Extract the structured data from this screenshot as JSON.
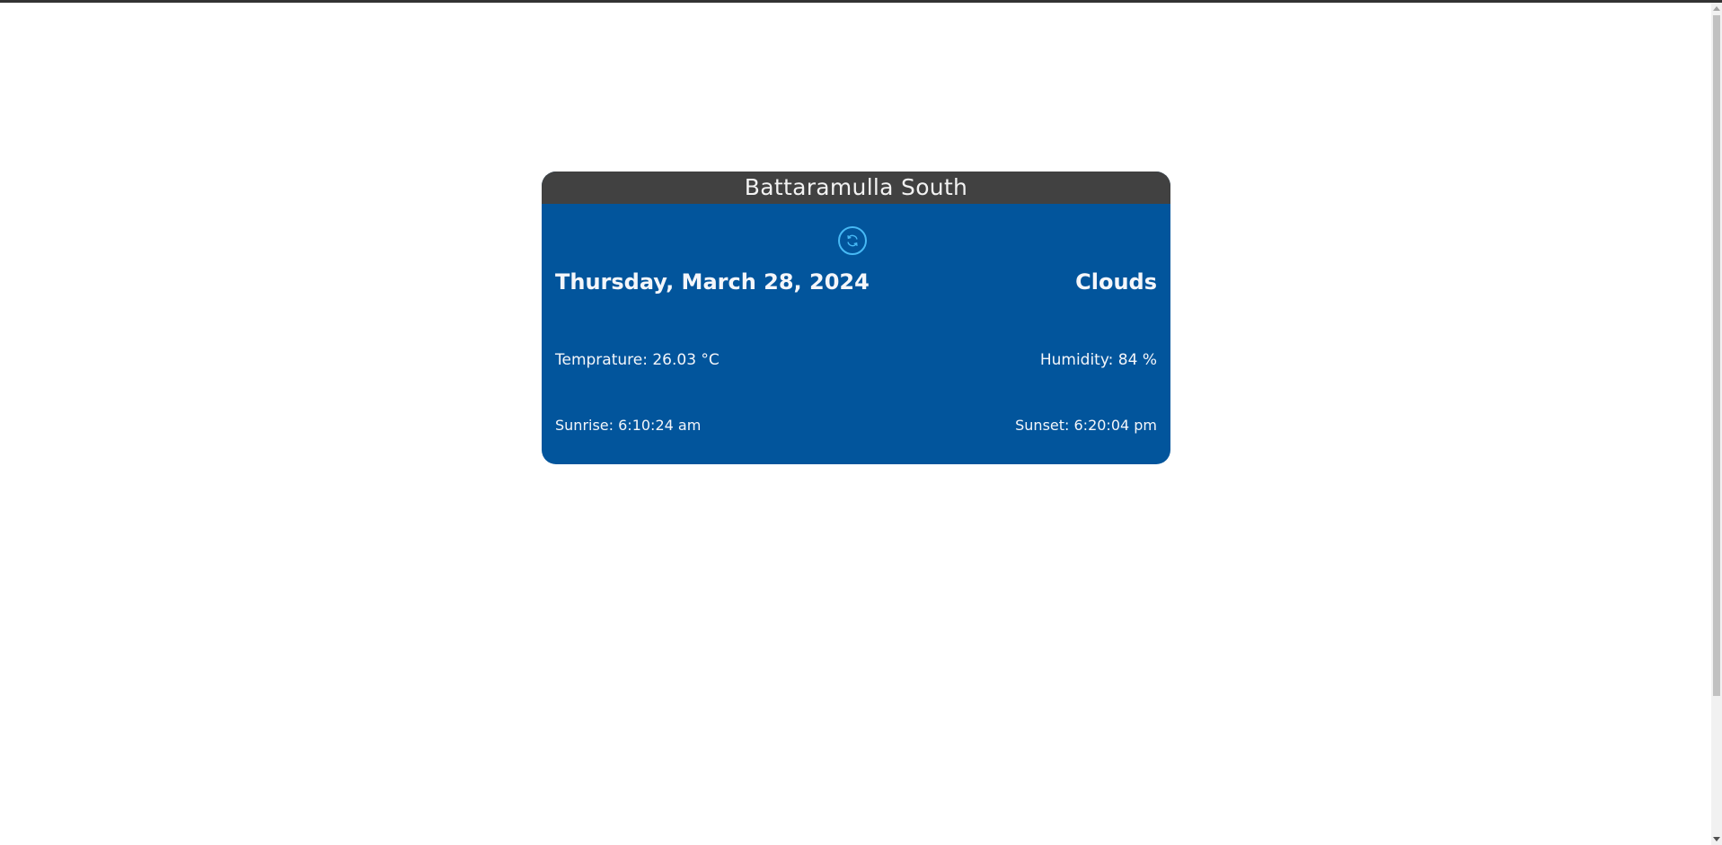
{
  "card": {
    "location": "Battaramulla South",
    "date": "Thursday, March 28, 2024",
    "condition": "Clouds",
    "temperature": "Temprature: 26.03 °C",
    "humidity": "Humidity: 84 %",
    "sunrise": "Sunrise: 6:10:24 am",
    "sunset": "Sunset: 6:20:04 pm",
    "refresh_icon": "refresh-icon"
  },
  "colors": {
    "header_bg": "#414141",
    "body_bg": "#02559c",
    "accent": "#47b9f5",
    "text": "#f4f6fa"
  }
}
